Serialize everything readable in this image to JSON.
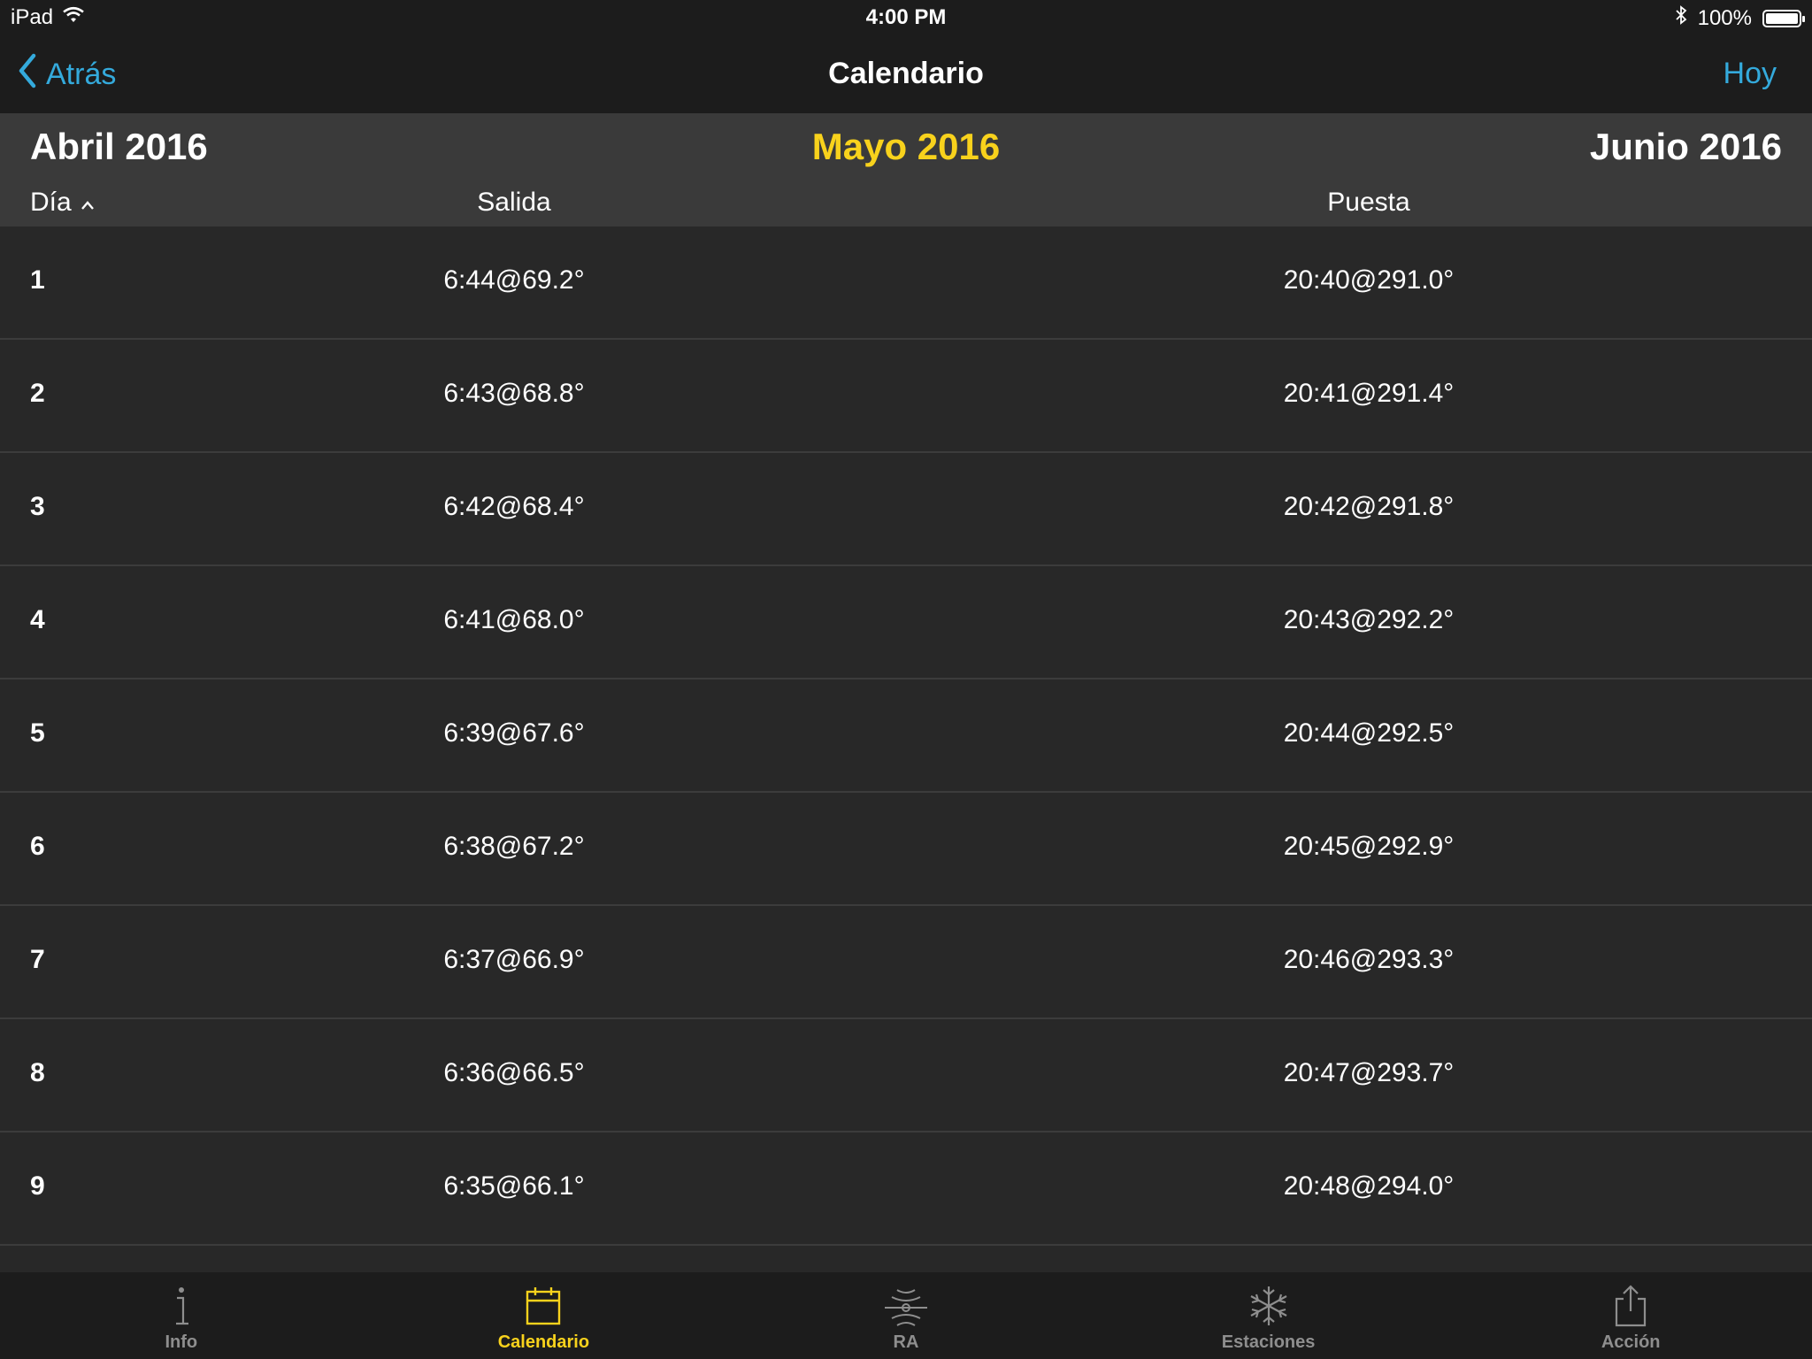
{
  "status_bar": {
    "device": "iPad",
    "time": "4:00 PM",
    "battery": "100%",
    "battery_level": 1.0
  },
  "nav": {
    "back_label": "Atrás",
    "title": "Calendario",
    "right_label": "Hoy"
  },
  "months": {
    "prev": "Abril 2016",
    "current": "Mayo 2016",
    "next": "Junio 2016"
  },
  "columns": {
    "day": "Día",
    "rise": "Salida",
    "set": "Puesta"
  },
  "rows": [
    {
      "day": "1",
      "rise": "6:44@69.2°",
      "set": "20:40@291.0°"
    },
    {
      "day": "2",
      "rise": "6:43@68.8°",
      "set": "20:41@291.4°"
    },
    {
      "day": "3",
      "rise": "6:42@68.4°",
      "set": "20:42@291.8°"
    },
    {
      "day": "4",
      "rise": "6:41@68.0°",
      "set": "20:43@292.2°"
    },
    {
      "day": "5",
      "rise": "6:39@67.6°",
      "set": "20:44@292.5°"
    },
    {
      "day": "6",
      "rise": "6:38@67.2°",
      "set": "20:45@292.9°"
    },
    {
      "day": "7",
      "rise": "6:37@66.9°",
      "set": "20:46@293.3°"
    },
    {
      "day": "8",
      "rise": "6:36@66.5°",
      "set": "20:47@293.7°"
    },
    {
      "day": "9",
      "rise": "6:35@66.1°",
      "set": "20:48@294.0°"
    }
  ],
  "tabs": [
    {
      "label": "Info",
      "icon": "info-icon",
      "active": false
    },
    {
      "label": "Calendario",
      "icon": "calendar-icon",
      "active": true
    },
    {
      "label": "RA",
      "icon": "ra-icon",
      "active": false
    },
    {
      "label": "Estaciones",
      "icon": "snowflake-icon",
      "active": false
    },
    {
      "label": "Acción",
      "icon": "share-icon",
      "active": false
    }
  ],
  "colors": {
    "accent_blue": "#34aadc",
    "accent_yellow": "#f8d21c",
    "background": "#282828",
    "bars": "#1c1c1c",
    "month_header": "#3a3a3a"
  }
}
